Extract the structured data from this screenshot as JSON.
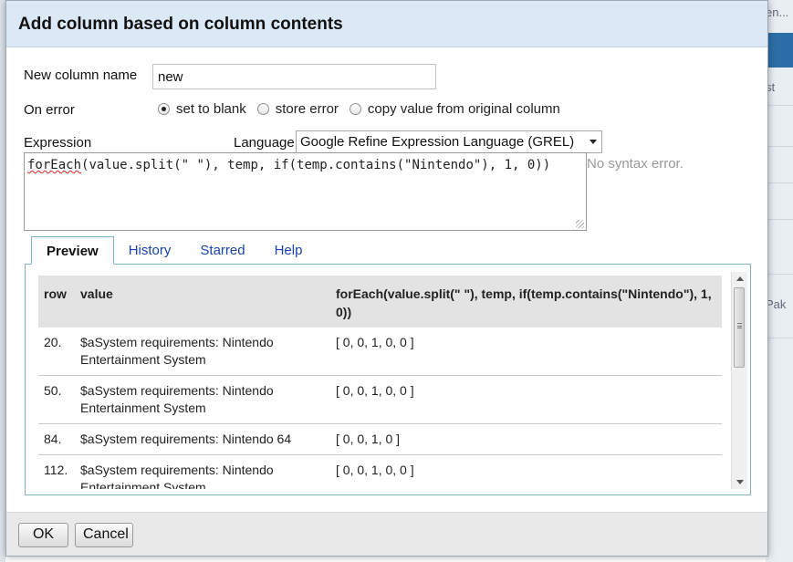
{
  "dialog": {
    "title": "Add column based on column contents"
  },
  "new_column": {
    "label": "New column name",
    "value": "new"
  },
  "on_error": {
    "label": "On error",
    "options": [
      "set to blank",
      "store error",
      "copy value from original column"
    ],
    "selected": "set to blank"
  },
  "expression": {
    "label": "Expression",
    "language_label": "Language",
    "language_value": "Google Refine Expression Language (GREL)",
    "code_first": "forEach",
    "code_rest": "(value.split(\" \"), temp, if(temp.contains(\"Nintendo\"), 1, 0))",
    "status": "No syntax error."
  },
  "tabs": [
    {
      "label": "Preview",
      "active": true
    },
    {
      "label": "History",
      "active": false
    },
    {
      "label": "Starred",
      "active": false
    },
    {
      "label": "Help",
      "active": false
    }
  ],
  "preview": {
    "headers": [
      "row",
      "value",
      "forEach(value.split(\" \"), temp, if(temp.contains(\"Nintendo\"), 1, 0))"
    ],
    "rows": [
      {
        "row": "20.",
        "value": "$aSystem requirements: Nintendo Entertainment System",
        "result": "[ 0, 0, 1, 0, 0 ]"
      },
      {
        "row": "50.",
        "value": "$aSystem requirements: Nintendo Entertainment System",
        "result": "[ 0, 0, 1, 0, 0 ]"
      },
      {
        "row": "84.",
        "value": "$aSystem requirements: Nintendo 64",
        "result": "[ 0, 0, 1, 0 ]"
      },
      {
        "row": "112.",
        "value": "$aSystem requirements: Nintendo Entertainment System",
        "result": "[ 0, 0, 1, 0, 0 ]"
      }
    ]
  },
  "buttons": {
    "ok": "OK",
    "cancel": "Cancel"
  },
  "background": {
    "fragments": [
      "en...",
      "st",
      "Pak"
    ]
  }
}
